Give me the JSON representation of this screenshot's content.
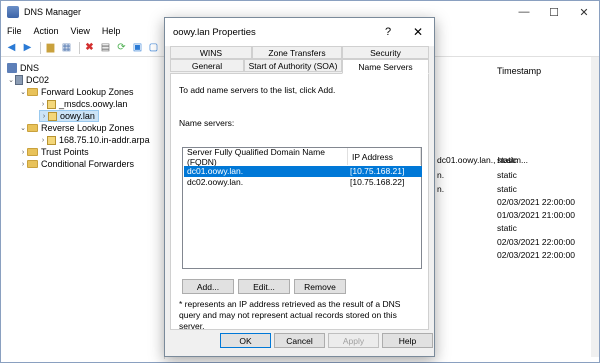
{
  "window": {
    "title": "DNS Manager"
  },
  "menu": [
    "File",
    "Action",
    "View",
    "Help"
  ],
  "tree": {
    "root": "DNS",
    "server": "DC02",
    "forward": "Forward Lookup Zones",
    "msdcs": "_msdcs.oowy.lan",
    "zone": "oowy.lan",
    "reverse": "Reverse Lookup Zones",
    "reverse_zone": "168.75.10.in-addr.arpa",
    "trust": "Trust Points",
    "conditional": "Conditional Forwarders"
  },
  "list": {
    "header": "Timestamp",
    "rows": [
      {
        "left": "",
        "right": ""
      },
      {
        "left": "dc01.oowy.lan., hostm...",
        "right": "static"
      },
      {
        "left": "n.",
        "right": "static"
      },
      {
        "left": "n.",
        "right": "static"
      },
      {
        "left": "",
        "right": "02/03/2021 22:00:00"
      },
      {
        "left": "",
        "right": "01/03/2021 21:00:00"
      },
      {
        "left": "",
        "right": "static"
      },
      {
        "left": "",
        "right": "02/03/2021 22:00:00"
      },
      {
        "left": "",
        "right": "02/03/2021 22:00:00"
      }
    ]
  },
  "dialog": {
    "title": "oowy.lan Properties",
    "help_glyph": "?",
    "close_glyph": "✕",
    "tabs_top": [
      "WINS",
      "Zone Transfers",
      "Security"
    ],
    "tabs_bottom": [
      "General",
      "Start of Authority (SOA)",
      "Name Servers"
    ],
    "intro": "To add name servers to the list, click Add.",
    "ns_label": "Name servers:",
    "col_fqdn": "Server Fully Qualified Domain Name (FQDN)",
    "col_ip": "IP Address",
    "servers": [
      {
        "fqdn": "dc01.oowy.lan.",
        "ip": "[10.75.168.21]"
      },
      {
        "fqdn": "dc02.oowy.lan.",
        "ip": "[10.75.168.22]"
      }
    ],
    "add": "Add...",
    "edit": "Edit...",
    "remove": "Remove",
    "note": "* represents an IP address retrieved as the result of a DNS query and may not represent actual records stored on this server.",
    "ok": "OK",
    "cancel": "Cancel",
    "apply": "Apply",
    "help": "Help"
  }
}
